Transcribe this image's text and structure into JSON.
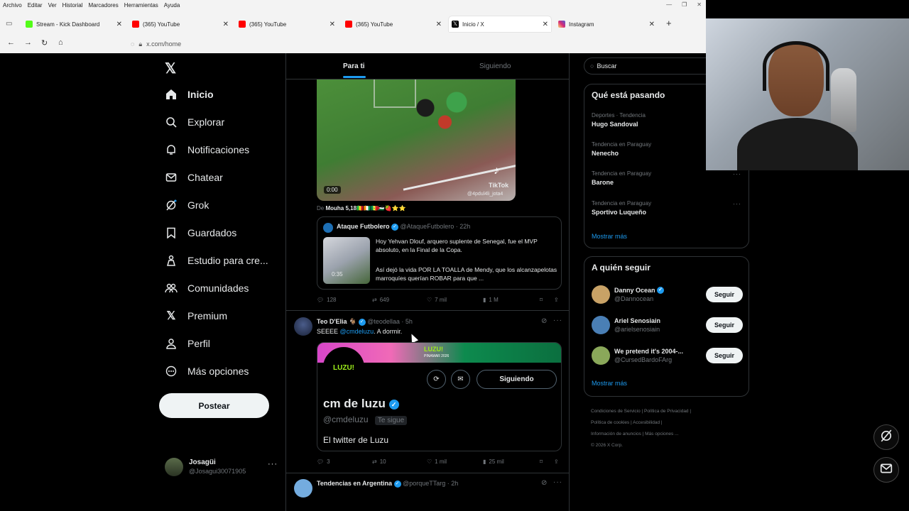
{
  "browser": {
    "menu": [
      "Archivo",
      "Editar",
      "Ver",
      "Historial",
      "Marcadores",
      "Herramientas",
      "Ayuda"
    ],
    "tabs": [
      {
        "title": "Stream - Kick Dashboard",
        "color": "#53fc18"
      },
      {
        "title": "(365) YouTube",
        "color": "#ff0000"
      },
      {
        "title": "(365) YouTube",
        "color": "#ff0000"
      },
      {
        "title": "(365) YouTube",
        "color": "#ff0000"
      },
      {
        "title": "Inicio / X",
        "color": "#000000"
      },
      {
        "title": "Instagram",
        "color": "#d62976"
      }
    ],
    "url": "x.com/home"
  },
  "nav": {
    "items": [
      "Inicio",
      "Explorar",
      "Notificaciones",
      "Chatear",
      "Grok",
      "Guardados",
      "Estudio para cre...",
      "Comunidades",
      "Premium",
      "Perfil",
      "Más opciones"
    ],
    "post_label": "Postear",
    "account_name": "Josagüi",
    "account_handle": "@Josagui30071905"
  },
  "feed": {
    "tab_for_you": "Para ti",
    "tab_following": "Siguiendo",
    "video_time": "0:00",
    "tiktok_label": "TikTok",
    "tiktok_handle": "@4pdul4li_jota4",
    "from_prefix": "De",
    "from_name": "Mouha 5,18🇲🇱🇨🇮🇸🇳🇵🇸🍓⭐⭐",
    "quote": {
      "name": "Ataque Futbolero",
      "handle": "@AtaqueFutbolero",
      "time": "· 22h",
      "text1": "Hoy Yehvan Dlouf, arquero suplente de Senegal, fue el MVP absoluto, en la Final de la Copa.",
      "text2": "Así dejó la vida POR LA TOALLA de Mendy, que los alcanzapelotas marroquíes querían ROBAR para que ...",
      "video_time": "0:35"
    },
    "post1_actions": {
      "replies": "128",
      "reposts": "649",
      "likes": "7 mil",
      "views": "1 M"
    },
    "post2": {
      "name": "Teo D'Elia 🐐",
      "handle": "@teodellaa",
      "time": "· 5h",
      "text_prefix": "SEEEE ",
      "mention": "@cmdeluzu",
      "text_suffix": ". A dormir.",
      "banner_text": "LUZU!",
      "banner_sub": "PINAMAR 2026",
      "avatar_text": "LUZU!",
      "following_label": "Siguiendo",
      "profile_name": "cm de luzu",
      "profile_handle": "@cmdeluzu",
      "follows_you": "Te sigue",
      "bio": "El twitter de Luzu",
      "actions": {
        "replies": "3",
        "reposts": "10",
        "likes": "1 mil",
        "views": "25 mil"
      }
    },
    "post3": {
      "name": "Tendencias en Argentina",
      "handle": "@porqueTTarg",
      "time": "· 2h"
    }
  },
  "right": {
    "search_placeholder": "Buscar",
    "trends_title": "Qué está pasando",
    "trends": [
      {
        "context": "Deportes · Tendencia",
        "name": "Hugo Sandoval"
      },
      {
        "context": "Tendencia en Paraguay",
        "name": "Nenecho"
      },
      {
        "context": "Tendencia en Paraguay",
        "name": "Barone"
      },
      {
        "context": "Tendencia en Paraguay",
        "name": "Sportivo Luqueño"
      }
    ],
    "show_more": "Mostrar más",
    "who_title": "A quién seguir",
    "who": [
      {
        "name": "Danny Ocean",
        "handle": "@Dannocean",
        "color": "#c8a266"
      },
      {
        "name": "Ariel Senosiain",
        "handle": "@arielsenosiain",
        "color": "#4a7fb5"
      },
      {
        "name": "We pretend it's 2004-...",
        "handle": "@CursedBardoFArg",
        "color": "#8aa85a"
      }
    ],
    "follow_label": "Seguir",
    "who_more": "Mostrar más",
    "footer": [
      "Condiciones de Servicio",
      "Política de Privacidad",
      "Política de cookies",
      "Accesibilidad",
      "Información de anuncios",
      "Más opciones ...",
      "© 2026 X Corp."
    ]
  }
}
